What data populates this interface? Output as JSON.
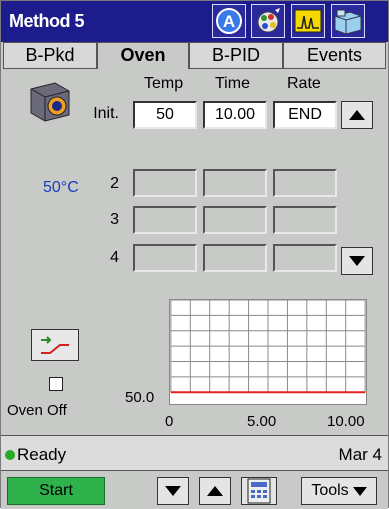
{
  "window": {
    "title": "Method 5"
  },
  "toolbar_icons": [
    {
      "name": "autosampler-icon"
    },
    {
      "name": "config-icon"
    },
    {
      "name": "chromatogram-icon"
    },
    {
      "name": "instrument-icon"
    }
  ],
  "tabs": [
    {
      "label": "B-Pkd",
      "active": false
    },
    {
      "label": "Oven",
      "active": true
    },
    {
      "label": "B-PID",
      "active": false
    },
    {
      "label": "Events",
      "active": false
    }
  ],
  "oven": {
    "current_temp": "50°C",
    "columns": {
      "temp": "Temp",
      "time": "Time",
      "rate": "Rate"
    },
    "rows": [
      {
        "label": "Init.",
        "temp": "50",
        "time": "10.00",
        "rate": "END"
      },
      {
        "label": "2",
        "temp": "",
        "time": "",
        "rate": ""
      },
      {
        "label": "3",
        "temp": "",
        "time": "",
        "rate": ""
      },
      {
        "label": "4",
        "temp": "",
        "time": "",
        "rate": ""
      }
    ],
    "oven_off_label": "Oven Off",
    "oven_off_checked": false
  },
  "chart_data": {
    "type": "line",
    "title": "",
    "xlabel": "",
    "ylabel": "",
    "x": [
      0,
      10.0
    ],
    "y": [
      50.0,
      50.0
    ],
    "x_ticks": [
      "0",
      "5.00",
      "10.00"
    ],
    "y_ticks": [
      "50.0"
    ],
    "xlim": [
      0,
      10.0
    ],
    "line_color": "#e02020",
    "grid": true
  },
  "status": {
    "text": "Ready",
    "date": "Mar 4",
    "indicator_color": "#2aa82a"
  },
  "bottom": {
    "start_label": "Start",
    "tools_label": "Tools"
  }
}
